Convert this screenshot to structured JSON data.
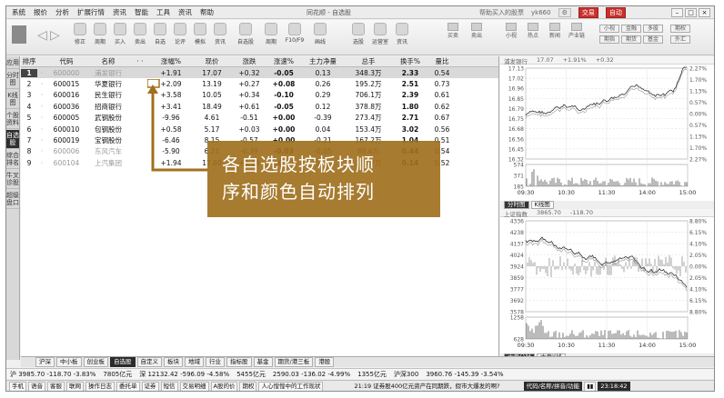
{
  "menus": [
    "系统",
    "报价",
    "分析",
    "扩展行情",
    "资讯",
    "智能",
    "工具",
    "资讯",
    "帮助"
  ],
  "app_title": "同花顺 - 自选股",
  "title_right": {
    "hint": "帮助买入的股票",
    "user": "yk660",
    "btn1": "交易",
    "btn2": "自动"
  },
  "toolbar_items": [
    "修正",
    "周期",
    "买入",
    "卖出",
    "自选",
    "论评",
    "模拟",
    "资讯",
    "自选股",
    "周期",
    "F10/F9",
    "画线",
    "选股",
    "运营室",
    "资讯"
  ],
  "toolbar_right": {
    "row1": [
      "买卖",
      "卖出",
      "买卖",
      "卖出",
      "卖出",
      "卖出",
      "卖出"
    ],
    "row2": [
      "小视",
      "热点",
      "新闻",
      "产业链",
      "小视",
      "期市",
      "期权"
    ],
    "boxes": [
      "小视",
      "金融",
      "多股",
      "期权",
      "期指",
      "期货",
      "基金",
      "外汇"
    ]
  },
  "sidebar": [
    "应用",
    "分时图",
    "K线图",
    "个股资料",
    "自选股",
    "综合排名",
    "牛叉诊股",
    "超级盘口"
  ],
  "columns": [
    "排序",
    "",
    "代码",
    "名称",
    "",
    "涨幅%",
    "现价",
    "涨跌",
    "涨速%",
    "主力净量",
    "总手",
    "换手%",
    "量比"
  ],
  "rows": [
    {
      "num": "1",
      "code": "600000",
      "name": "浦发银行",
      "chg": "+1.91",
      "price": "17.07",
      "diff": "+0.32",
      "speed": "-0.05",
      "net": "0.13",
      "vol": "348.3万",
      "turn": "2.33",
      "ratio": "0.54"
    },
    {
      "num": "2",
      "code": "600015",
      "name": "华夏银行",
      "chg": "+2.09",
      "price": "13.19",
      "diff": "+0.27",
      "speed": "+0.08",
      "net": "0.26",
      "vol": "195.2万",
      "turn": "2.51",
      "ratio": "0.73"
    },
    {
      "num": "3",
      "code": "600016",
      "name": "民生银行",
      "chg": "+3.58",
      "price": "10.05",
      "diff": "+0.34",
      "speed": "-0.10",
      "net": "0.29",
      "vol": "706.1万",
      "turn": "2.39",
      "ratio": "0.61"
    },
    {
      "num": "4",
      "code": "600036",
      "name": "招商银行",
      "chg": "+3.41",
      "price": "18.49",
      "diff": "+0.61",
      "speed": "-0.05",
      "net": "0.12",
      "vol": "378.8万",
      "turn": "1.80",
      "ratio": "0.62"
    },
    {
      "num": "5",
      "code": "600005",
      "name": "武钢股份",
      "chg": "-9.96",
      "price": "4.61",
      "diff": "-0.51",
      "speed": "+0.00",
      "net": "-0.39",
      "vol": "273.4万",
      "turn": "2.71",
      "ratio": "0.67"
    },
    {
      "num": "6",
      "code": "600010",
      "name": "包钢股份",
      "chg": "+0.58",
      "price": "5.17",
      "diff": "+0.03",
      "speed": "+0.00",
      "net": "0.04",
      "vol": "153.4万",
      "turn": "3.02",
      "ratio": "0.56"
    },
    {
      "num": "7",
      "code": "600019",
      "name": "宝钢股份",
      "chg": "-6.46",
      "price": "8.15",
      "diff": "-0.57",
      "speed": "+0.00",
      "net": "-0.21",
      "vol": "167.2万",
      "turn": "1.04",
      "ratio": "0.51"
    },
    {
      "num": "8",
      "code": "600006",
      "name": "东风汽车",
      "chg": "-5.90",
      "price": "6.21",
      "diff": "-0.39",
      "speed": "-0.03",
      "net": "-0.05",
      "vol": "88.6万",
      "turn": "0.44",
      "ratio": "0.54"
    },
    {
      "num": "9",
      "code": "600104",
      "name": "上汽集团",
      "chg": "+1.94",
      "price": "17.80",
      "diff": "+0.34",
      "speed": "+0.11",
      "net": "0.08",
      "vol": "155.7万",
      "turn": "0.14",
      "ratio": "0.52"
    }
  ],
  "annotation": {
    "line1": "各自选股按板块顺",
    "line2": "序和颜色自动排列"
  },
  "chart1": {
    "header": [
      "浦发银行",
      "17.07",
      "+1.91%",
      "+0.32"
    ],
    "left_ticks": [
      "17.13",
      "17.02",
      "16.96",
      "16.85",
      "16.79",
      "16.75",
      "16.68",
      "16.56",
      "16.45",
      "16.32"
    ],
    "right_ticks": [
      "2.27%",
      "1.70%",
      "1.13%",
      "0.57%",
      "0.00%",
      "0.57%",
      "1.13%",
      "1.70%",
      "2.27%"
    ],
    "vol_ticks": [
      "574",
      "371",
      "185"
    ],
    "x_ticks": [
      "09:30",
      "10:30",
      "11:30",
      "14:00",
      "15:00"
    ],
    "tabs": [
      "分时图",
      "K线图"
    ]
  },
  "chart2": {
    "header": [
      "上证指数",
      "3865.70",
      "-118.70"
    ],
    "left_ticks": [
      "4336",
      "4238",
      "4137",
      "4024",
      "3924",
      "3859",
      "3777",
      "3692",
      "3578"
    ],
    "right_ticks": [
      "8.80%",
      "6.15%",
      "4.10%",
      "2.05%",
      "0.00%",
      "2.05%",
      "4.10%",
      "6.15%",
      "8.80%"
    ],
    "vol_ticks": [
      "1258",
      "628"
    ],
    "x_ticks": [
      "09:30",
      "10:30",
      "11:30",
      "14:00",
      "15:00"
    ],
    "tabs": [
      "大盘分时",
      "大盘K线"
    ]
  },
  "tabs": [
    "沪深",
    "中小板",
    "创业板",
    "自选股",
    "自定义",
    "板块",
    "地域",
    "行业",
    "指标股",
    "基金",
    "期货/港三板",
    "港股"
  ],
  "active_tab": "自选股",
  "index_bar": [
    "沪 3985.70 -118.70 -3.83%",
    "7805亿元",
    "深 12132.42 -596.09 -4.58%",
    "5455亿元",
    "2590.03 -136.02 -4.99%",
    "1355亿元",
    "沪深300",
    "3960.76 -145.39 -3.54%"
  ],
  "status_bar": [
    "手机",
    "语音",
    "客服",
    "联网",
    "操作日志",
    "委托单",
    "证券",
    "短信",
    "交易明细",
    "A股的价",
    "期权",
    "人心惶惶中的工作现状"
  ],
  "ticker": "21:19 证券股400亿元资产在同期跌，假市大爆发的啊?",
  "status_right": [
    "代码/名称/拼音/功能",
    "",
    "23:18:42"
  ]
}
